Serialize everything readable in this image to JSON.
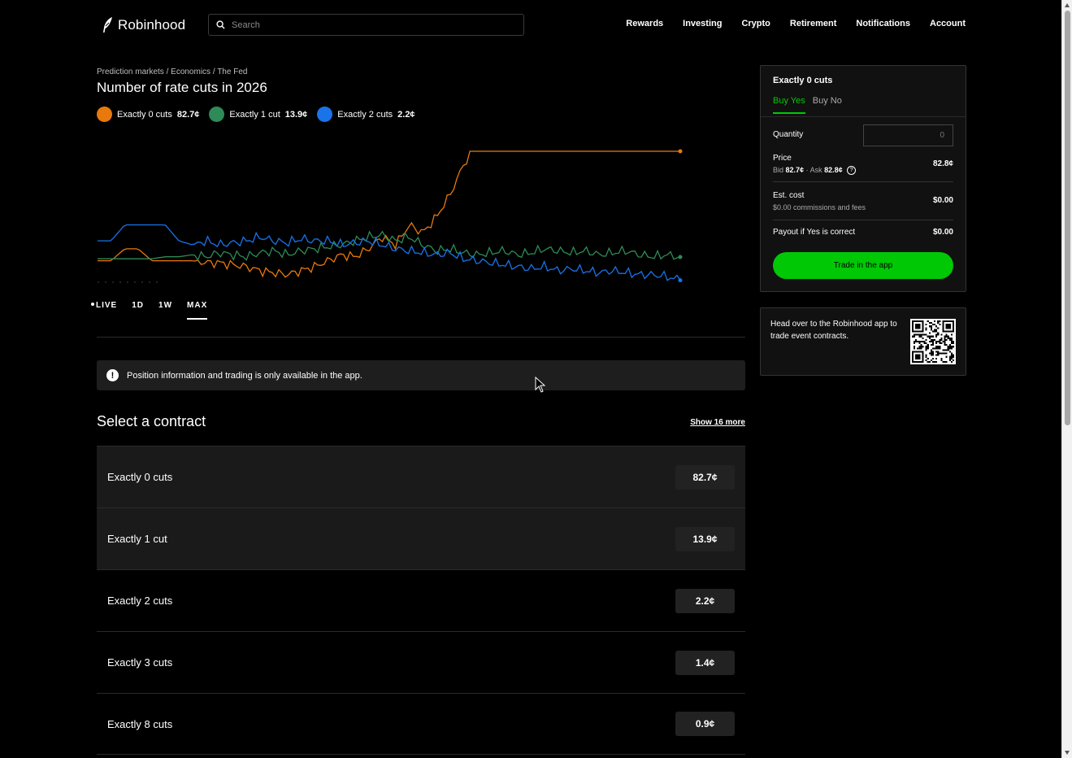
{
  "header": {
    "brand": "Robinhood",
    "search_placeholder": "Search",
    "nav": [
      "Rewards",
      "Investing",
      "Crypto",
      "Retirement",
      "Notifications",
      "Account"
    ]
  },
  "market": {
    "breadcrumb": "Prediction markets / Economics / The Fed",
    "title": "Number of rate cuts in 2026",
    "legend": [
      {
        "label": "Exactly 0 cuts",
        "value": "82.7¢",
        "color": "#e8790c"
      },
      {
        "label": "Exactly 1 cut",
        "value": "13.9¢",
        "color": "#2e8b57"
      },
      {
        "label": "Exactly 2 cuts",
        "value": "2.2¢",
        "color": "#1a73e8"
      }
    ],
    "time_tabs": {
      "live": "LIVE",
      "d1": "1D",
      "w1": "1W",
      "max": "MAX"
    },
    "active_tab": "MAX"
  },
  "chart_data": {
    "type": "line",
    "series": [
      {
        "name": "Exactly 0 cuts",
        "color": "#e8790c",
        "values": [
          12,
          12,
          18,
          18,
          12,
          12,
          12,
          12,
          11,
          11,
          10,
          9,
          7,
          6,
          5,
          7,
          9,
          12,
          15,
          14,
          18,
          24,
          20,
          30,
          26,
          34,
          45,
          60,
          72,
          68,
          74,
          70,
          75,
          72,
          76,
          74,
          77,
          79,
          76,
          80,
          82,
          81,
          83,
          82.7
        ]
      },
      {
        "name": "Exactly 1 cut",
        "color": "#2e8b57",
        "values": [
          13,
          13,
          13,
          13,
          13,
          14,
          14,
          15,
          14,
          16,
          15,
          14,
          16,
          17,
          15,
          17,
          18,
          19,
          20,
          22,
          24,
          25,
          22,
          24,
          20,
          17,
          18,
          16,
          15,
          16,
          17,
          15,
          16,
          18,
          17,
          16,
          17,
          15,
          16,
          17,
          15,
          14,
          15,
          13.9
        ]
      },
      {
        "name": "Exactly 2 cuts",
        "color": "#1a73e8",
        "values": [
          22,
          22,
          30,
          30,
          30,
          30,
          22,
          20,
          22,
          20,
          21,
          22,
          24,
          22,
          21,
          23,
          22,
          22,
          20,
          21,
          22,
          20,
          18,
          17,
          16,
          15,
          16,
          13,
          12,
          11,
          10,
          9,
          8,
          9,
          7,
          8,
          7,
          6,
          7,
          6,
          5,
          5,
          4,
          2.2
        ]
      }
    ],
    "ylim": [
      0,
      100
    ]
  },
  "alert": {
    "text": "Position information and trading is only available in the app."
  },
  "contracts": {
    "heading": "Select a contract",
    "show_more": "Show 16 more",
    "rows": [
      {
        "name": "Exactly 0 cuts",
        "price": "82.7¢"
      },
      {
        "name": "Exactly 1 cut",
        "price": "13.9¢"
      },
      {
        "name": "Exactly 2 cuts",
        "price": "2.2¢"
      },
      {
        "name": "Exactly 3 cuts",
        "price": "1.4¢"
      },
      {
        "name": "Exactly 8 cuts",
        "price": "0.9¢"
      }
    ]
  },
  "trade": {
    "title": "Exactly 0 cuts",
    "tab_yes": "Buy Yes",
    "tab_no": "Buy No",
    "quantity_label": "Quantity",
    "quantity_placeholder": "0",
    "price_label": "Price",
    "bid_label": "Bid",
    "bid_value": "82.7¢",
    "ask_label": "· Ask",
    "ask_value": "82.8¢",
    "price_value": "82.8¢",
    "est_cost_label": "Est. cost",
    "est_cost_sub": "$0.00 commissions and fees",
    "est_cost_value": "$0.00",
    "payout_label": "Payout if Yes is correct",
    "payout_value": "$0.00",
    "button": "Trade in the app"
  },
  "app_promo": {
    "text": "Head over to the Robinhood app to trade event contracts."
  }
}
